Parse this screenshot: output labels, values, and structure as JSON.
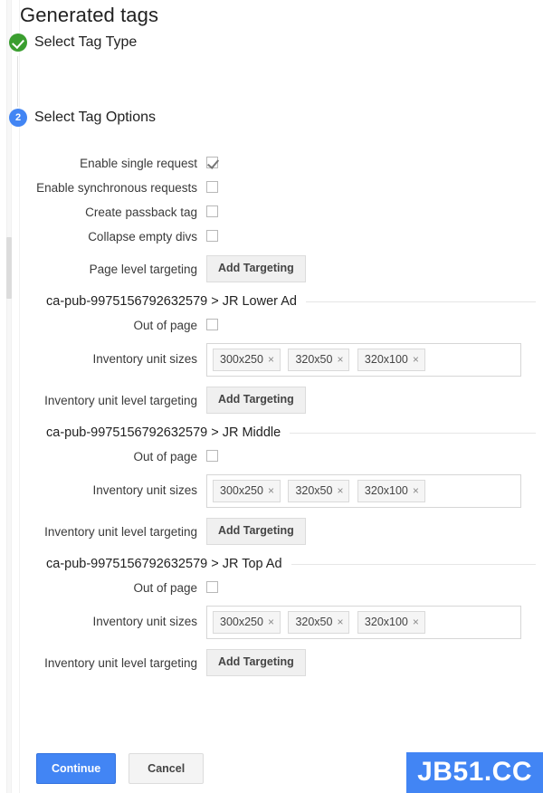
{
  "page": {
    "title": "Generated tags"
  },
  "steps": [
    {
      "state": "done",
      "label": "Select Tag Type",
      "icon": "check-circle-icon",
      "badge": ""
    },
    {
      "state": "current",
      "label": "Select Tag Options",
      "icon": "step-number-icon",
      "badge": "2"
    }
  ],
  "options": [
    {
      "label": "Enable single request",
      "type": "checkbox",
      "checked": true
    },
    {
      "label": "Enable synchronous requests",
      "type": "checkbox",
      "checked": false
    },
    {
      "label": "Create passback tag",
      "type": "checkbox",
      "checked": false
    },
    {
      "label": "Collapse empty divs",
      "type": "checkbox",
      "checked": false
    },
    {
      "label": "Page level targeting",
      "type": "button",
      "button_label": "Add Targeting"
    }
  ],
  "units": [
    {
      "title": "ca-pub-9975156792632579 > JR Lower Ad",
      "out_of_page_label": "Out of page",
      "out_of_page_checked": false,
      "sizes_label": "Inventory unit sizes",
      "sizes": [
        "300x250",
        "320x50",
        "320x100"
      ],
      "targeting_label": "Inventory unit level targeting",
      "targeting_button": "Add Targeting"
    },
    {
      "title": "ca-pub-9975156792632579 > JR Middle",
      "out_of_page_label": "Out of page",
      "out_of_page_checked": false,
      "sizes_label": "Inventory unit sizes",
      "sizes": [
        "300x250",
        "320x50",
        "320x100"
      ],
      "targeting_label": "Inventory unit level targeting",
      "targeting_button": "Add Targeting"
    },
    {
      "title": "ca-pub-9975156792632579 > JR Top Ad",
      "out_of_page_label": "Out of page",
      "out_of_page_checked": false,
      "sizes_label": "Inventory unit sizes",
      "sizes": [
        "300x250",
        "320x50",
        "320x100"
      ],
      "targeting_label": "Inventory unit level targeting",
      "targeting_button": "Add Targeting"
    }
  ],
  "chip_remove_glyph": "×",
  "footer": {
    "continue_label": "Continue",
    "cancel_label": "Cancel"
  },
  "watermark": {
    "text": "JB51.CC",
    "background": "#4285f4",
    "color": "#ffffff"
  },
  "colors": {
    "accent_blue": "#4285f4",
    "done_green": "#3a9e2f",
    "text": "#212121",
    "label_text": "#3a3a3a",
    "border": "#d6d6d6",
    "chip_bg": "#f5f5f5",
    "button_grey_bg": "#f0f0f0"
  }
}
